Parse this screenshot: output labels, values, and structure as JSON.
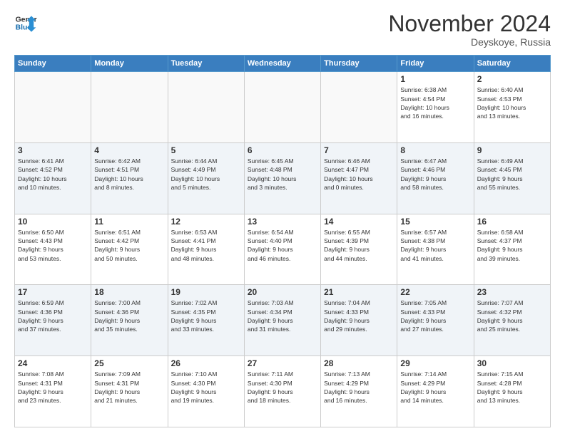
{
  "header": {
    "logo_line1": "General",
    "logo_line2": "Blue",
    "month": "November 2024",
    "location": "Deyskoye, Russia"
  },
  "weekdays": [
    "Sunday",
    "Monday",
    "Tuesday",
    "Wednesday",
    "Thursday",
    "Friday",
    "Saturday"
  ],
  "weeks": [
    [
      {
        "day": "",
        "info": ""
      },
      {
        "day": "",
        "info": ""
      },
      {
        "day": "",
        "info": ""
      },
      {
        "day": "",
        "info": ""
      },
      {
        "day": "",
        "info": ""
      },
      {
        "day": "1",
        "info": "Sunrise: 6:38 AM\nSunset: 4:54 PM\nDaylight: 10 hours\nand 16 minutes."
      },
      {
        "day": "2",
        "info": "Sunrise: 6:40 AM\nSunset: 4:53 PM\nDaylight: 10 hours\nand 13 minutes."
      }
    ],
    [
      {
        "day": "3",
        "info": "Sunrise: 6:41 AM\nSunset: 4:52 PM\nDaylight: 10 hours\nand 10 minutes."
      },
      {
        "day": "4",
        "info": "Sunrise: 6:42 AM\nSunset: 4:51 PM\nDaylight: 10 hours\nand 8 minutes."
      },
      {
        "day": "5",
        "info": "Sunrise: 6:44 AM\nSunset: 4:49 PM\nDaylight: 10 hours\nand 5 minutes."
      },
      {
        "day": "6",
        "info": "Sunrise: 6:45 AM\nSunset: 4:48 PM\nDaylight: 10 hours\nand 3 minutes."
      },
      {
        "day": "7",
        "info": "Sunrise: 6:46 AM\nSunset: 4:47 PM\nDaylight: 10 hours\nand 0 minutes."
      },
      {
        "day": "8",
        "info": "Sunrise: 6:47 AM\nSunset: 4:46 PM\nDaylight: 9 hours\nand 58 minutes."
      },
      {
        "day": "9",
        "info": "Sunrise: 6:49 AM\nSunset: 4:45 PM\nDaylight: 9 hours\nand 55 minutes."
      }
    ],
    [
      {
        "day": "10",
        "info": "Sunrise: 6:50 AM\nSunset: 4:43 PM\nDaylight: 9 hours\nand 53 minutes."
      },
      {
        "day": "11",
        "info": "Sunrise: 6:51 AM\nSunset: 4:42 PM\nDaylight: 9 hours\nand 50 minutes."
      },
      {
        "day": "12",
        "info": "Sunrise: 6:53 AM\nSunset: 4:41 PM\nDaylight: 9 hours\nand 48 minutes."
      },
      {
        "day": "13",
        "info": "Sunrise: 6:54 AM\nSunset: 4:40 PM\nDaylight: 9 hours\nand 46 minutes."
      },
      {
        "day": "14",
        "info": "Sunrise: 6:55 AM\nSunset: 4:39 PM\nDaylight: 9 hours\nand 44 minutes."
      },
      {
        "day": "15",
        "info": "Sunrise: 6:57 AM\nSunset: 4:38 PM\nDaylight: 9 hours\nand 41 minutes."
      },
      {
        "day": "16",
        "info": "Sunrise: 6:58 AM\nSunset: 4:37 PM\nDaylight: 9 hours\nand 39 minutes."
      }
    ],
    [
      {
        "day": "17",
        "info": "Sunrise: 6:59 AM\nSunset: 4:36 PM\nDaylight: 9 hours\nand 37 minutes."
      },
      {
        "day": "18",
        "info": "Sunrise: 7:00 AM\nSunset: 4:36 PM\nDaylight: 9 hours\nand 35 minutes."
      },
      {
        "day": "19",
        "info": "Sunrise: 7:02 AM\nSunset: 4:35 PM\nDaylight: 9 hours\nand 33 minutes."
      },
      {
        "day": "20",
        "info": "Sunrise: 7:03 AM\nSunset: 4:34 PM\nDaylight: 9 hours\nand 31 minutes."
      },
      {
        "day": "21",
        "info": "Sunrise: 7:04 AM\nSunset: 4:33 PM\nDaylight: 9 hours\nand 29 minutes."
      },
      {
        "day": "22",
        "info": "Sunrise: 7:05 AM\nSunset: 4:33 PM\nDaylight: 9 hours\nand 27 minutes."
      },
      {
        "day": "23",
        "info": "Sunrise: 7:07 AM\nSunset: 4:32 PM\nDaylight: 9 hours\nand 25 minutes."
      }
    ],
    [
      {
        "day": "24",
        "info": "Sunrise: 7:08 AM\nSunset: 4:31 PM\nDaylight: 9 hours\nand 23 minutes."
      },
      {
        "day": "25",
        "info": "Sunrise: 7:09 AM\nSunset: 4:31 PM\nDaylight: 9 hours\nand 21 minutes."
      },
      {
        "day": "26",
        "info": "Sunrise: 7:10 AM\nSunset: 4:30 PM\nDaylight: 9 hours\nand 19 minutes."
      },
      {
        "day": "27",
        "info": "Sunrise: 7:11 AM\nSunset: 4:30 PM\nDaylight: 9 hours\nand 18 minutes."
      },
      {
        "day": "28",
        "info": "Sunrise: 7:13 AM\nSunset: 4:29 PM\nDaylight: 9 hours\nand 16 minutes."
      },
      {
        "day": "29",
        "info": "Sunrise: 7:14 AM\nSunset: 4:29 PM\nDaylight: 9 hours\nand 14 minutes."
      },
      {
        "day": "30",
        "info": "Sunrise: 7:15 AM\nSunset: 4:28 PM\nDaylight: 9 hours\nand 13 minutes."
      }
    ]
  ]
}
